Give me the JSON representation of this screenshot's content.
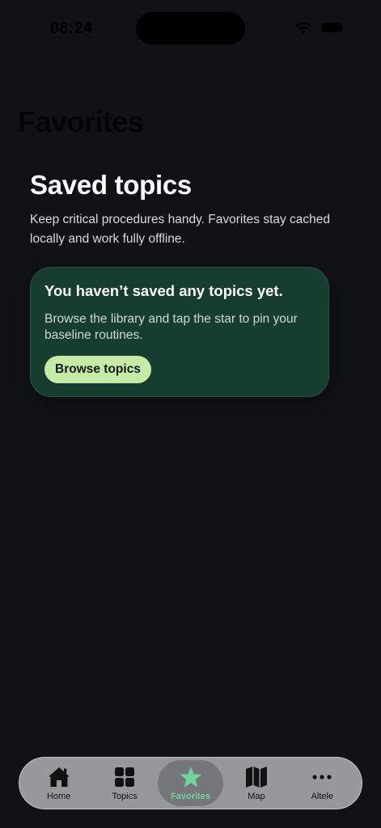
{
  "status_bar": {
    "time": "08:24"
  },
  "nav": {
    "title": "Favorites"
  },
  "section": {
    "title": "Saved topics",
    "description": "Keep critical procedures handy. Favorites stay cached locally and work fully offline."
  },
  "empty_state": {
    "title": "You haven’t saved any topics yet.",
    "description": "Browse the library and tap the star to pin your baseline routines.",
    "button_label": "Browse topics"
  },
  "tab_bar": {
    "active_tab": "Favorites",
    "accent_color": "#72d29c",
    "items": [
      {
        "label": "Home",
        "icon": "home-icon"
      },
      {
        "label": "Topics",
        "icon": "grid-icon"
      },
      {
        "label": "Favorites",
        "icon": "star-icon"
      },
      {
        "label": "Map",
        "icon": "map-icon"
      },
      {
        "label": "Altele",
        "icon": "more-icon"
      }
    ]
  },
  "colors": {
    "background": "#111216",
    "card": "#163d2f",
    "button": "#c6eaa7"
  }
}
